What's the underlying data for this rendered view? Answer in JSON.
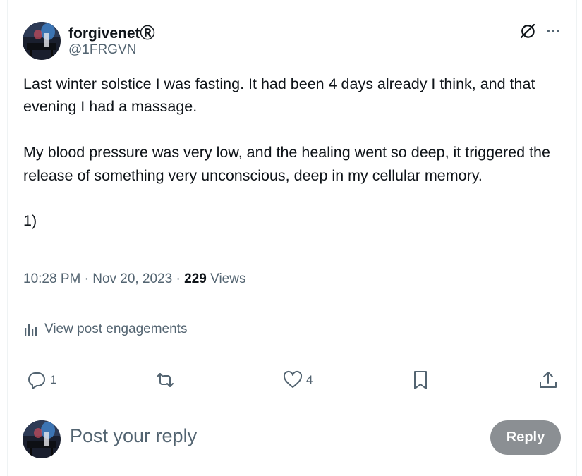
{
  "colors": {
    "text_primary": "#0f1419",
    "text_secondary": "#536471",
    "divider": "#eff3f4",
    "reply_button_bg": "#8b8f93"
  },
  "author": {
    "name": "forgivenet",
    "badge": "Ⓡ",
    "handle": "@1FRGVN"
  },
  "post": {
    "text": "Last winter solstice I was fasting. It had been 4 days already I think, and that evening I had a massage.\n\nMy blood pressure was very low, and the healing went so deep, it triggered the release of something very unconscious, deep in my cellular memory.\n\n1)",
    "time": "10:28 PM",
    "separator": "·",
    "date": "Nov 20, 2023",
    "views_count": "229",
    "views_label": "Views"
  },
  "engagements_link": "View post engagements",
  "actions": {
    "reply_count": "1",
    "repost_count": "",
    "like_count": "4"
  },
  "reply_box": {
    "placeholder": "Post your reply",
    "button_label": "Reply"
  },
  "icons": [
    "grok-icon",
    "more-icon",
    "analytics-icon",
    "reply-icon",
    "repost-icon",
    "like-icon",
    "bookmark-icon",
    "share-icon"
  ]
}
